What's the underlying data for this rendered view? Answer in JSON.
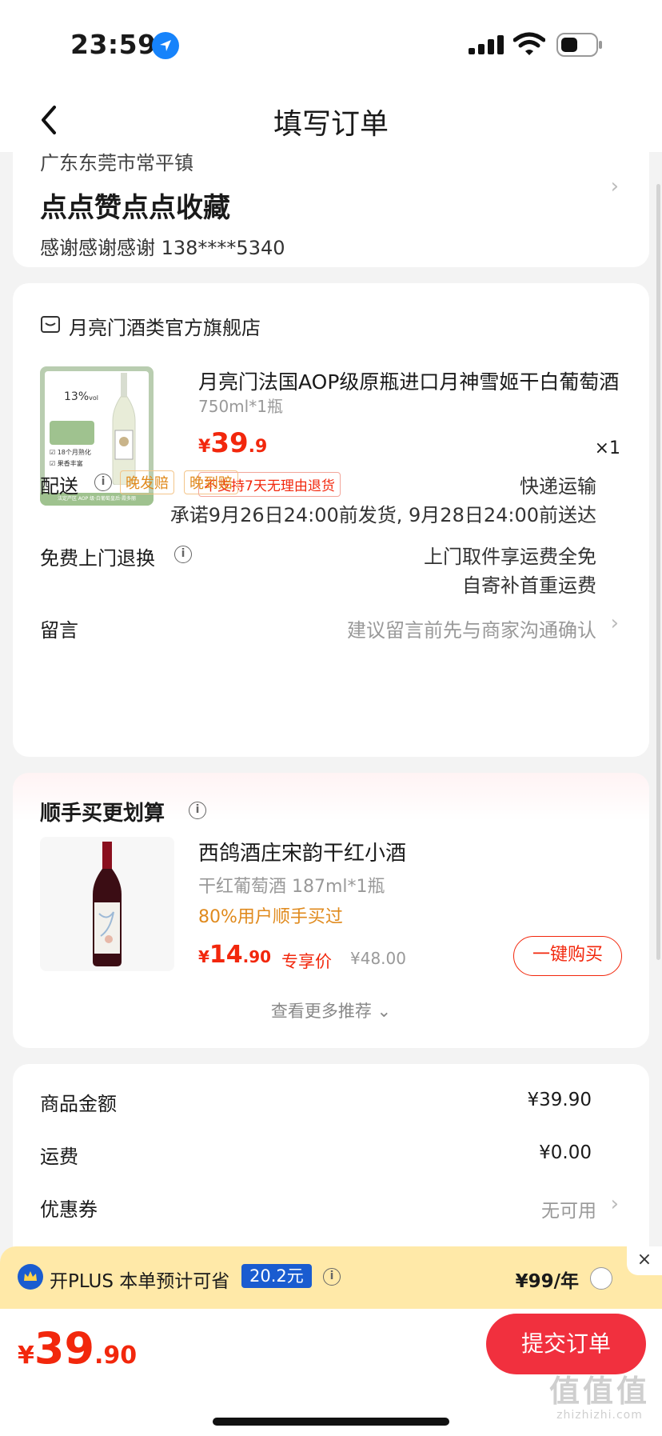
{
  "status_bar": {
    "time": "23:59"
  },
  "nav": {
    "title": "填写订单"
  },
  "address": {
    "region": "广东东莞市常平镇",
    "detail": "点点赞点点收藏",
    "contact": "感谢感谢感谢  138****5340"
  },
  "shop": {
    "name": "月亮门酒类官方旗舰店",
    "product": {
      "title": "月亮门法国AOP级原瓶进口月神雪姬干白葡萄酒",
      "spec": "750ml*1瓶",
      "price_symbol": "¥",
      "price_int": "39",
      "price_dec": ".9",
      "qty": "×1",
      "return_tag": "不支持7天无理由退货",
      "image_text": {
        "abv": "13%",
        "vol": "vol",
        "line1": "18个月熟化",
        "line2": "果香丰富",
        "footer": "法定产区 AOP 级·白葡萄皇后·霞多丽"
      }
    },
    "delivery": {
      "label": "配送",
      "tag1": "晚发赔",
      "tag2": "晚到赔",
      "method": "快递运输",
      "promise": "承诺9月26日24:00前发货, 9月28日24:00前送达"
    },
    "returns": {
      "label": "免费上门退换",
      "line1": "上门取件享运费全免",
      "line2": "自寄补首重运费"
    },
    "note": {
      "label": "留言",
      "hint": "建议留言前先与商家沟通确认"
    }
  },
  "recommend": {
    "title": "顺手买更划算",
    "item": {
      "name": "西鸽酒庄宋韵干红小酒",
      "spec": "干红葡萄酒 187ml*1瓶",
      "social": "80%用户顺手买过",
      "price_symbol": "¥",
      "price_int": "14",
      "price_dec": ".90",
      "price_label": "专享价",
      "original": "¥48.00",
      "buy_label": "一键购买"
    },
    "more": "查看更多推荐"
  },
  "summary": {
    "goods_label": "商品金额",
    "goods_value": "¥39.90",
    "freight_label": "运费",
    "freight_value": "¥0.00",
    "coupon_label": "优惠券",
    "coupon_value": "无可用"
  },
  "plus": {
    "text": "开PLUS 本单预计可省",
    "saving": "20.2元",
    "price": "¥99/年",
    "close": "×"
  },
  "bottom": {
    "price_symbol": "¥",
    "price_int": "39",
    "price_dec": ".90",
    "submit": "提交订单"
  },
  "watermark": {
    "main": "值值值",
    "sub": "zhizhizhi.com"
  },
  "colors": {
    "accent": "#f2270c",
    "submit": "#f1303e",
    "plus_blue": "#1a5cd0",
    "plus_bg": "#ffe9a8",
    "tag_orange": "#e08a1d"
  }
}
